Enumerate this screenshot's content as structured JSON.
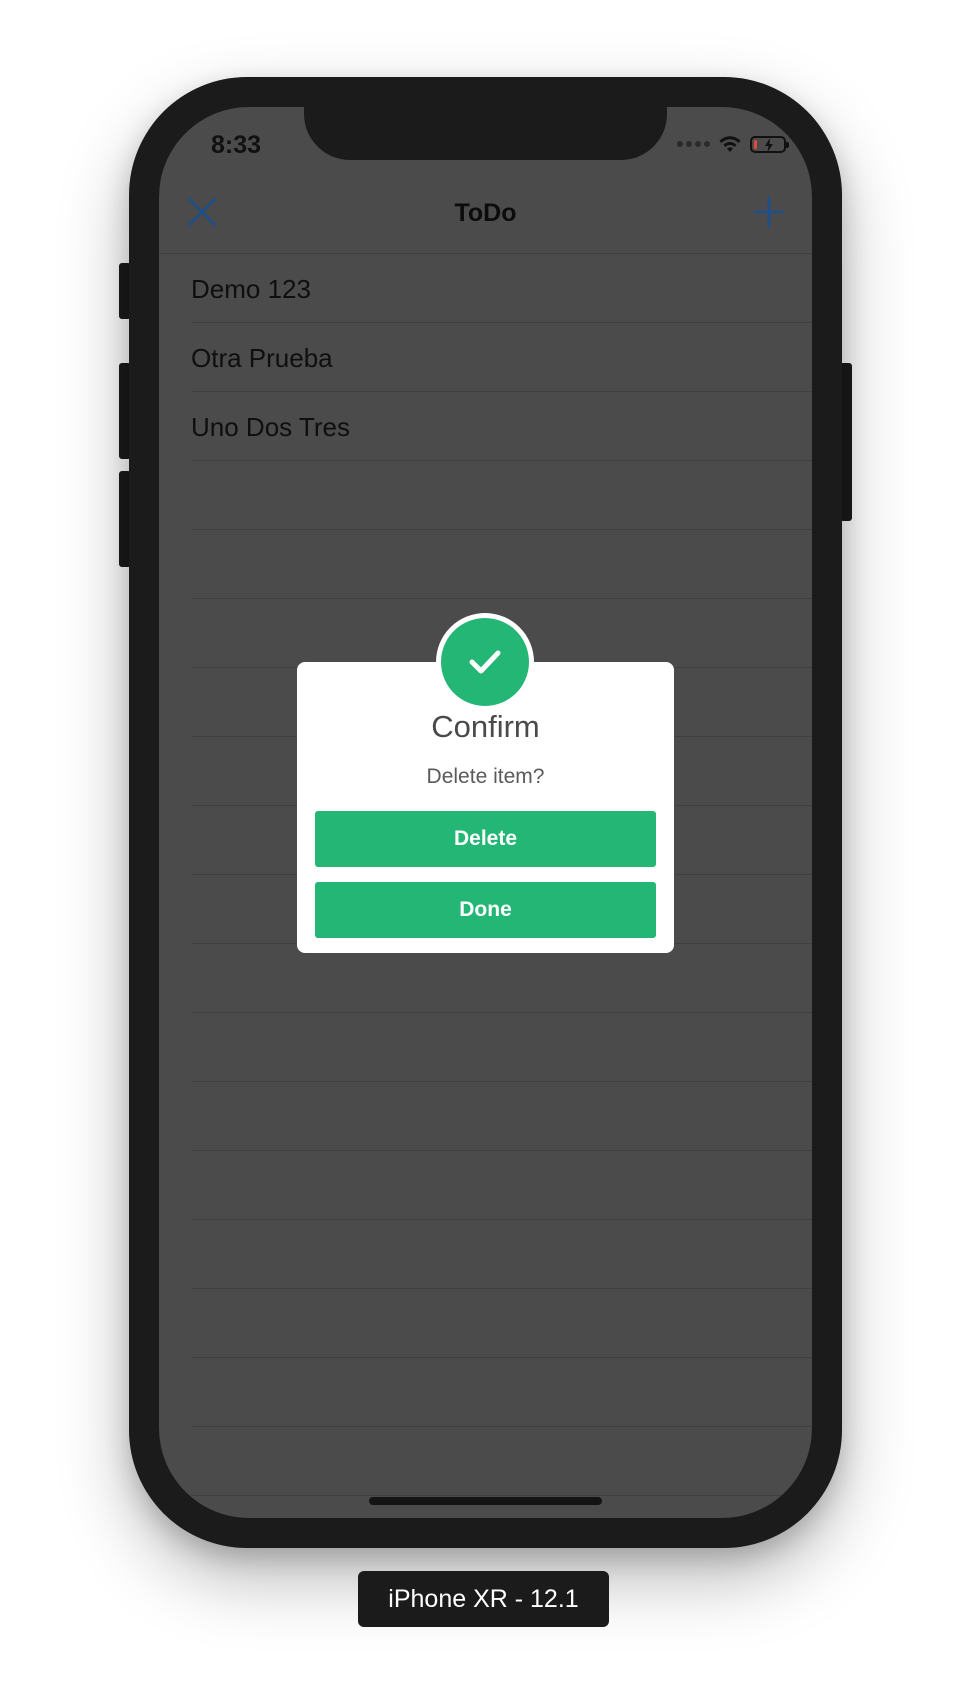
{
  "status_bar": {
    "time": "8:33"
  },
  "navbar": {
    "title": "ToDo",
    "left_icon": "close-icon",
    "right_icon": "plus-icon",
    "accent_color": "#1c4f8c"
  },
  "list": {
    "items": [
      {
        "label": "Demo 123"
      },
      {
        "label": "Otra Prueba"
      },
      {
        "label": "Uno Dos Tres"
      },
      {
        "label": ""
      },
      {
        "label": ""
      },
      {
        "label": ""
      },
      {
        "label": ""
      },
      {
        "label": ""
      },
      {
        "label": ""
      },
      {
        "label": ""
      },
      {
        "label": ""
      },
      {
        "label": ""
      },
      {
        "label": ""
      },
      {
        "label": ""
      },
      {
        "label": ""
      },
      {
        "label": ""
      },
      {
        "label": ""
      },
      {
        "label": ""
      }
    ]
  },
  "dialog": {
    "icon": "checkmark-icon",
    "title": "Confirm",
    "message": "Delete item?",
    "primary_button": "Delete",
    "secondary_button": "Done",
    "accent_color": "#24b675"
  },
  "device_label": "iPhone XR - 12.1"
}
